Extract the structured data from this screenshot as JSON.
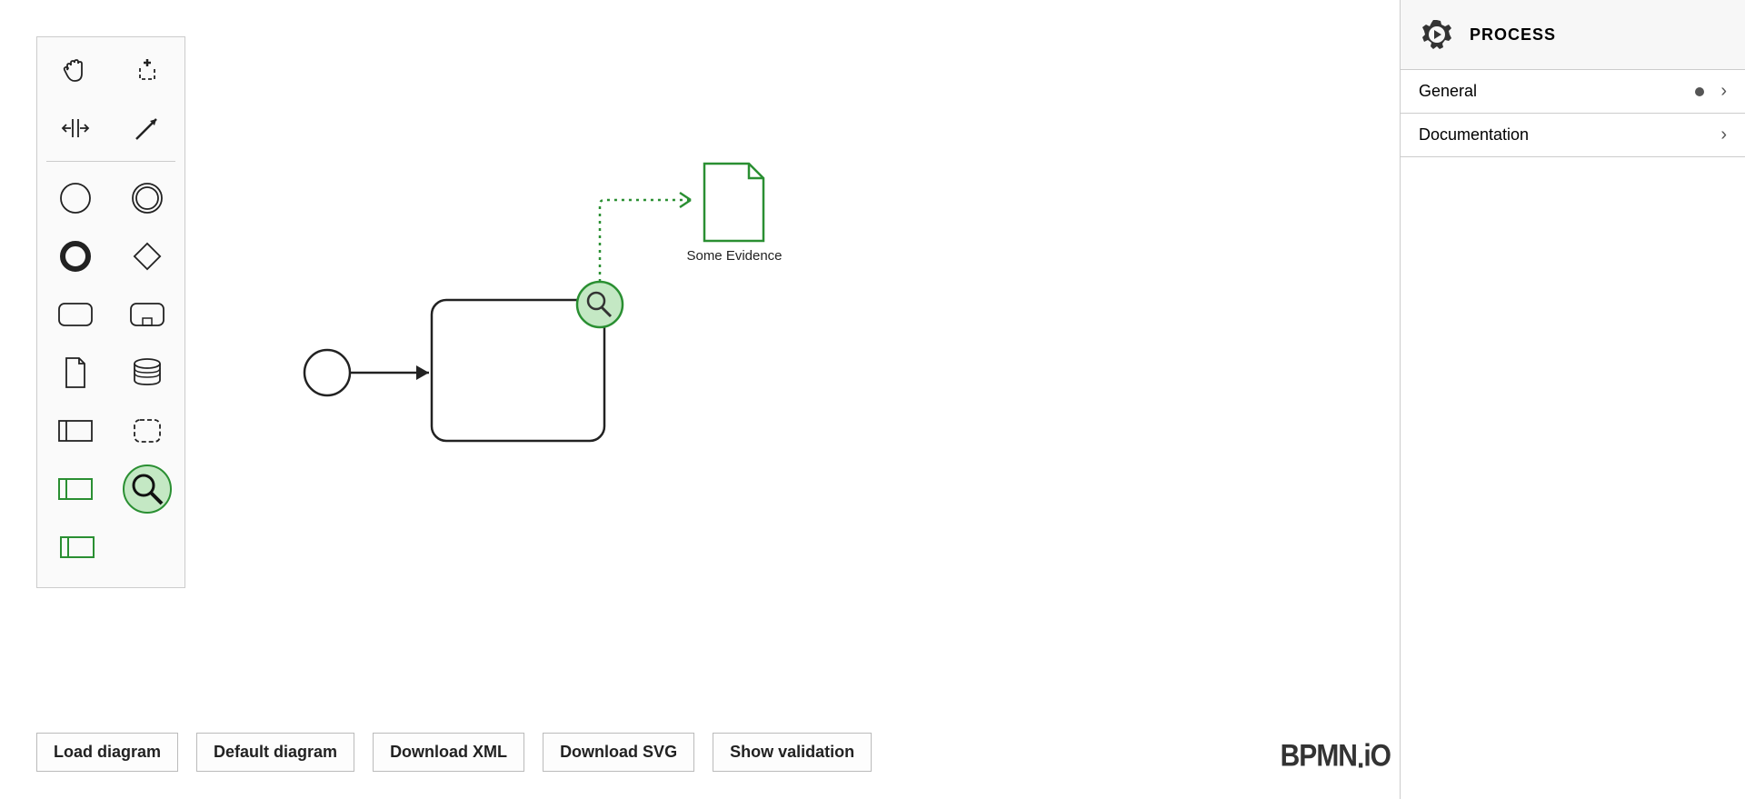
{
  "palette": {
    "tools": {
      "hand": "hand-tool",
      "lasso": "lasso-tool",
      "space": "space-tool",
      "connect": "global-connect-tool"
    },
    "shapes": {
      "start_event": "start-event",
      "end_event": "end-event",
      "intermediate_event": "intermediate-event",
      "gateway": "gateway",
      "task": "task",
      "subprocess": "subprocess",
      "data_object": "data-object",
      "data_store": "data-store",
      "participant": "participant",
      "group": "group",
      "green_participant": "evidence-context",
      "magnify": "evidence-source",
      "green_task": "evidence-task"
    }
  },
  "diagram": {
    "data_object_label": "Some Evidence"
  },
  "buttons": {
    "load": "Load diagram",
    "default": "Default diagram",
    "download_xml": "Download XML",
    "download_svg": "Download SVG",
    "show_validation": "Show validation"
  },
  "logo": "BPMN.iO",
  "properties": {
    "title": "PROCESS",
    "sections": {
      "general": "General",
      "documentation": "Documentation"
    }
  },
  "colors": {
    "green": "#2a8f32",
    "green_fill": "#c4e8c4"
  }
}
